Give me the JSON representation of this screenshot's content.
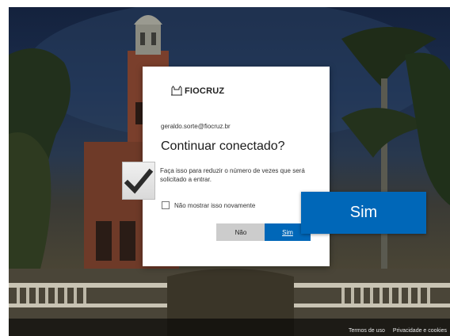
{
  "dialog": {
    "logo_text": "FIOCRUZ",
    "email": "geraldo.sorte@fiocruz.br",
    "title": "Continuar conectado?",
    "description": "Faça isso para reduzir o número de vezes que será solicitado a entrar.",
    "checkbox_label": "Não mostrar isso novamente",
    "checkbox_checked": false,
    "no_button": "Não",
    "yes_button": "Sim"
  },
  "zoom_callout": {
    "label": "Sim"
  },
  "footer": {
    "terms": "Termos de uso",
    "privacy": "Privacidade e cookies"
  },
  "colors": {
    "primary_button": "#0067b8",
    "secondary_button": "#cccccc"
  },
  "icons": {
    "logo": "fiocruz-castle-icon",
    "check_overlay": "checkmark-icon"
  }
}
